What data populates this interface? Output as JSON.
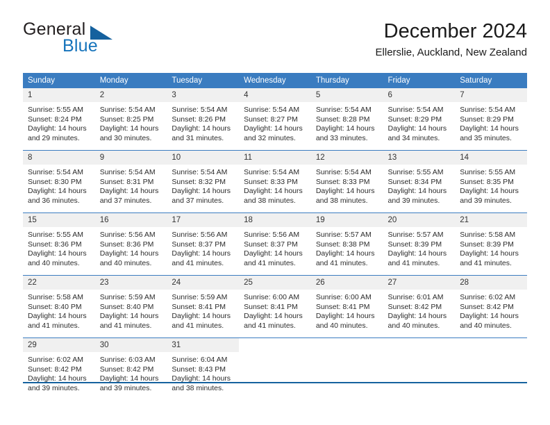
{
  "brand": {
    "name_part1": "General",
    "name_part2": "Blue",
    "logo_icon": "triangle-logo-icon",
    "colors": {
      "dark": "#231f20",
      "blue": "#1573bb",
      "triangle": "#15619e"
    }
  },
  "header": {
    "month_title": "December 2024",
    "location": "Ellerslie, Auckland, New Zealand"
  },
  "calendar": {
    "header_bg": "#3a7cc0",
    "daynum_bg": "#f0f0f0",
    "weekday_headers": [
      "Sunday",
      "Monday",
      "Tuesday",
      "Wednesday",
      "Thursday",
      "Friday",
      "Saturday"
    ],
    "weeks": [
      [
        {
          "day": "1",
          "sunrise": "Sunrise: 5:55 AM",
          "sunset": "Sunset: 8:24 PM",
          "daylight_line1": "Daylight: 14 hours",
          "daylight_line2": "and 29 minutes."
        },
        {
          "day": "2",
          "sunrise": "Sunrise: 5:54 AM",
          "sunset": "Sunset: 8:25 PM",
          "daylight_line1": "Daylight: 14 hours",
          "daylight_line2": "and 30 minutes."
        },
        {
          "day": "3",
          "sunrise": "Sunrise: 5:54 AM",
          "sunset": "Sunset: 8:26 PM",
          "daylight_line1": "Daylight: 14 hours",
          "daylight_line2": "and 31 minutes."
        },
        {
          "day": "4",
          "sunrise": "Sunrise: 5:54 AM",
          "sunset": "Sunset: 8:27 PM",
          "daylight_line1": "Daylight: 14 hours",
          "daylight_line2": "and 32 minutes."
        },
        {
          "day": "5",
          "sunrise": "Sunrise: 5:54 AM",
          "sunset": "Sunset: 8:28 PM",
          "daylight_line1": "Daylight: 14 hours",
          "daylight_line2": "and 33 minutes."
        },
        {
          "day": "6",
          "sunrise": "Sunrise: 5:54 AM",
          "sunset": "Sunset: 8:29 PM",
          "daylight_line1": "Daylight: 14 hours",
          "daylight_line2": "and 34 minutes."
        },
        {
          "day": "7",
          "sunrise": "Sunrise: 5:54 AM",
          "sunset": "Sunset: 8:29 PM",
          "daylight_line1": "Daylight: 14 hours",
          "daylight_line2": "and 35 minutes."
        }
      ],
      [
        {
          "day": "8",
          "sunrise": "Sunrise: 5:54 AM",
          "sunset": "Sunset: 8:30 PM",
          "daylight_line1": "Daylight: 14 hours",
          "daylight_line2": "and 36 minutes."
        },
        {
          "day": "9",
          "sunrise": "Sunrise: 5:54 AM",
          "sunset": "Sunset: 8:31 PM",
          "daylight_line1": "Daylight: 14 hours",
          "daylight_line2": "and 37 minutes."
        },
        {
          "day": "10",
          "sunrise": "Sunrise: 5:54 AM",
          "sunset": "Sunset: 8:32 PM",
          "daylight_line1": "Daylight: 14 hours",
          "daylight_line2": "and 37 minutes."
        },
        {
          "day": "11",
          "sunrise": "Sunrise: 5:54 AM",
          "sunset": "Sunset: 8:33 PM",
          "daylight_line1": "Daylight: 14 hours",
          "daylight_line2": "and 38 minutes."
        },
        {
          "day": "12",
          "sunrise": "Sunrise: 5:54 AM",
          "sunset": "Sunset: 8:33 PM",
          "daylight_line1": "Daylight: 14 hours",
          "daylight_line2": "and 38 minutes."
        },
        {
          "day": "13",
          "sunrise": "Sunrise: 5:55 AM",
          "sunset": "Sunset: 8:34 PM",
          "daylight_line1": "Daylight: 14 hours",
          "daylight_line2": "and 39 minutes."
        },
        {
          "day": "14",
          "sunrise": "Sunrise: 5:55 AM",
          "sunset": "Sunset: 8:35 PM",
          "daylight_line1": "Daylight: 14 hours",
          "daylight_line2": "and 39 minutes."
        }
      ],
      [
        {
          "day": "15",
          "sunrise": "Sunrise: 5:55 AM",
          "sunset": "Sunset: 8:36 PM",
          "daylight_line1": "Daylight: 14 hours",
          "daylight_line2": "and 40 minutes."
        },
        {
          "day": "16",
          "sunrise": "Sunrise: 5:56 AM",
          "sunset": "Sunset: 8:36 PM",
          "daylight_line1": "Daylight: 14 hours",
          "daylight_line2": "and 40 minutes."
        },
        {
          "day": "17",
          "sunrise": "Sunrise: 5:56 AM",
          "sunset": "Sunset: 8:37 PM",
          "daylight_line1": "Daylight: 14 hours",
          "daylight_line2": "and 41 minutes."
        },
        {
          "day": "18",
          "sunrise": "Sunrise: 5:56 AM",
          "sunset": "Sunset: 8:37 PM",
          "daylight_line1": "Daylight: 14 hours",
          "daylight_line2": "and 41 minutes."
        },
        {
          "day": "19",
          "sunrise": "Sunrise: 5:57 AM",
          "sunset": "Sunset: 8:38 PM",
          "daylight_line1": "Daylight: 14 hours",
          "daylight_line2": "and 41 minutes."
        },
        {
          "day": "20",
          "sunrise": "Sunrise: 5:57 AM",
          "sunset": "Sunset: 8:39 PM",
          "daylight_line1": "Daylight: 14 hours",
          "daylight_line2": "and 41 minutes."
        },
        {
          "day": "21",
          "sunrise": "Sunrise: 5:58 AM",
          "sunset": "Sunset: 8:39 PM",
          "daylight_line1": "Daylight: 14 hours",
          "daylight_line2": "and 41 minutes."
        }
      ],
      [
        {
          "day": "22",
          "sunrise": "Sunrise: 5:58 AM",
          "sunset": "Sunset: 8:40 PM",
          "daylight_line1": "Daylight: 14 hours",
          "daylight_line2": "and 41 minutes."
        },
        {
          "day": "23",
          "sunrise": "Sunrise: 5:59 AM",
          "sunset": "Sunset: 8:40 PM",
          "daylight_line1": "Daylight: 14 hours",
          "daylight_line2": "and 41 minutes."
        },
        {
          "day": "24",
          "sunrise": "Sunrise: 5:59 AM",
          "sunset": "Sunset: 8:41 PM",
          "daylight_line1": "Daylight: 14 hours",
          "daylight_line2": "and 41 minutes."
        },
        {
          "day": "25",
          "sunrise": "Sunrise: 6:00 AM",
          "sunset": "Sunset: 8:41 PM",
          "daylight_line1": "Daylight: 14 hours",
          "daylight_line2": "and 41 minutes."
        },
        {
          "day": "26",
          "sunrise": "Sunrise: 6:00 AM",
          "sunset": "Sunset: 8:41 PM",
          "daylight_line1": "Daylight: 14 hours",
          "daylight_line2": "and 40 minutes."
        },
        {
          "day": "27",
          "sunrise": "Sunrise: 6:01 AM",
          "sunset": "Sunset: 8:42 PM",
          "daylight_line1": "Daylight: 14 hours",
          "daylight_line2": "and 40 minutes."
        },
        {
          "day": "28",
          "sunrise": "Sunrise: 6:02 AM",
          "sunset": "Sunset: 8:42 PM",
          "daylight_line1": "Daylight: 14 hours",
          "daylight_line2": "and 40 minutes."
        }
      ],
      [
        {
          "day": "29",
          "sunrise": "Sunrise: 6:02 AM",
          "sunset": "Sunset: 8:42 PM",
          "daylight_line1": "Daylight: 14 hours",
          "daylight_line2": "and 39 minutes."
        },
        {
          "day": "30",
          "sunrise": "Sunrise: 6:03 AM",
          "sunset": "Sunset: 8:42 PM",
          "daylight_line1": "Daylight: 14 hours",
          "daylight_line2": "and 39 minutes."
        },
        {
          "day": "31",
          "sunrise": "Sunrise: 6:04 AM",
          "sunset": "Sunset: 8:43 PM",
          "daylight_line1": "Daylight: 14 hours",
          "daylight_line2": "and 38 minutes."
        },
        {
          "day": "",
          "sunrise": "",
          "sunset": "",
          "daylight_line1": "",
          "daylight_line2": ""
        },
        {
          "day": "",
          "sunrise": "",
          "sunset": "",
          "daylight_line1": "",
          "daylight_line2": ""
        },
        {
          "day": "",
          "sunrise": "",
          "sunset": "",
          "daylight_line1": "",
          "daylight_line2": ""
        },
        {
          "day": "",
          "sunrise": "",
          "sunset": "",
          "daylight_line1": "",
          "daylight_line2": ""
        }
      ]
    ]
  }
}
